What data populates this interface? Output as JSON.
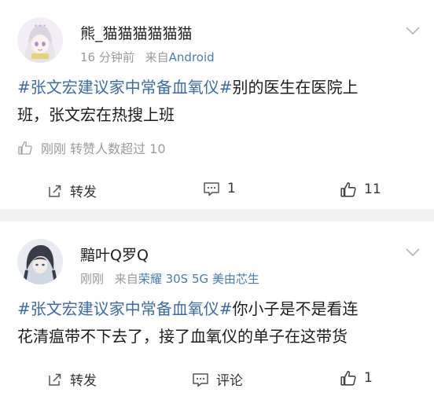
{
  "posts": [
    {
      "username": "熊_猫猫猫猫猫猫",
      "time": "16 分钟前",
      "via": "来自",
      "source": "Android",
      "topic": "#张文宏建议家中常备血氧仪#",
      "text_line1_rest": "别的医生在医院上",
      "text_line2": "班，张文宏在热搜上班",
      "likes_info": "刚刚  转赞人数超过 10",
      "repost_label": "转发",
      "comment_label": "1",
      "like_count": "11"
    },
    {
      "username": "黯叶Q罗Q",
      "time": "刚刚",
      "via": "来自",
      "source": "荣耀 30S 5G 美由芯生",
      "topic": "#张文宏建议家中常备血氧仪#",
      "text_line1_rest": "你小子是不是看连",
      "text_line2": "花清瘟带不下去了，接了血氧仪的单子在这带货",
      "repost_label": "转发",
      "comment_label": "评论",
      "like_count": "1"
    }
  ],
  "colors": {
    "topic": "#3d6aa8",
    "meta": "#9a9a9a",
    "source": "#4a7bb5",
    "separator": "#f1f1f1"
  },
  "icons": [
    "chevron-down-icon",
    "thumbs-up-icon",
    "repost-icon",
    "comment-icon"
  ]
}
